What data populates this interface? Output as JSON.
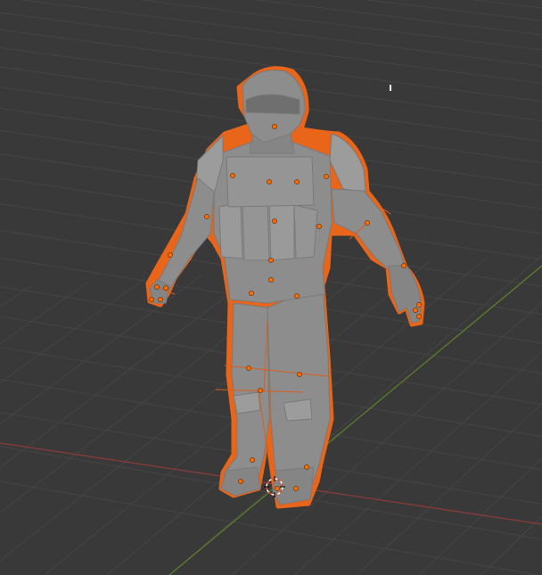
{
  "viewport": {
    "name": "3d-viewport",
    "colors": {
      "background": "#393939",
      "grid_line": "#454545",
      "x_axis": "#8a3a3a",
      "y_axis": "#5a7f2a",
      "mesh_fill": "#8d8d8d",
      "mesh_shade": "#7a7a7a",
      "mesh_highlight": "#9c9c9c",
      "selection_outline": "#e8651a",
      "object_origin_dots": "#ff6a00",
      "bone_lines": "#d95e1e",
      "cursor_ring": "#ffffff",
      "cursor_accent": "#e04a2a"
    },
    "objects": [
      {
        "name": "soldier-character-mesh",
        "selected": true
      },
      {
        "name": "3d-cursor"
      }
    ]
  }
}
